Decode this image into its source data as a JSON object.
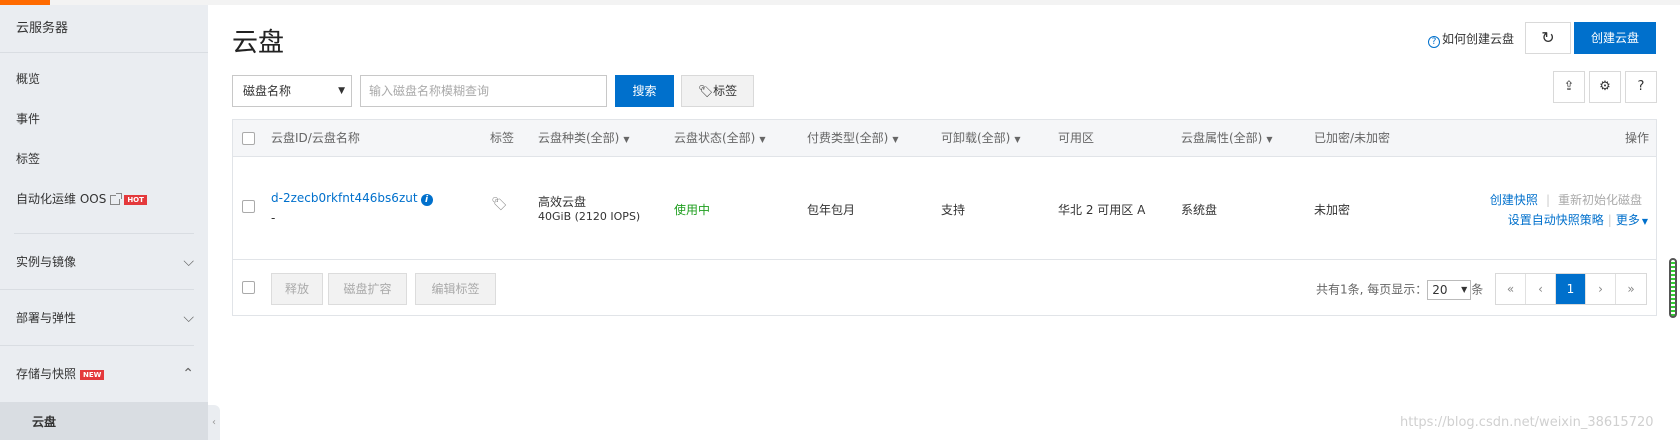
{
  "sidebar": {
    "title": "云服务器",
    "items": [
      {
        "label": "概览"
      },
      {
        "label": "事件"
      },
      {
        "label": "标签"
      },
      {
        "label": "自动化运维 OOS",
        "badge": "HOT"
      }
    ],
    "groups": [
      {
        "label": "实例与镜像",
        "chevron": "chevron-down-icon"
      },
      {
        "label": "部署与弹性",
        "chevron": "chevron-down-icon"
      },
      {
        "label": "存储与快照",
        "badge": "NEW",
        "chevron": "chevron-up-icon"
      }
    ],
    "active_sub": "云盘"
  },
  "header": {
    "title": "云盘",
    "howto_label": "如何创建云盘",
    "refresh_icon": "refresh-icon",
    "create_label": "创建云盘"
  },
  "filter": {
    "field_value": "磁盘名称",
    "search_placeholder": "输入磁盘名称模糊查询",
    "search_label": "搜索",
    "tag_label": "标签",
    "help_label": "?"
  },
  "table": {
    "columns": {
      "id": "云盘ID/云盘名称",
      "tag": "标签",
      "kind": "云盘种类(全部)",
      "status": "云盘状态(全部)",
      "billing": "付费类型(全部)",
      "detachable": "可卸载(全部)",
      "zone": "可用区",
      "attribute": "云盘属性(全部)",
      "encryption": "已加密/未加密",
      "actions": "操作"
    },
    "rows": [
      {
        "id": "d-2zecb0rkfnt446bs6zut",
        "name": "-",
        "kind": "高效云盘",
        "size": "40GiB (2120 IOPS)",
        "status": "使用中",
        "billing": "包年包月",
        "detachable": "支持",
        "zone": "华北 2 可用区 A",
        "attribute": "系统盘",
        "encryption": "未加密",
        "action_snapshot": "创建快照",
        "action_reinit": "重新初始化磁盘",
        "action_policy": "设置自动快照策略",
        "action_more": "更多"
      }
    ],
    "footer": {
      "release_label": "释放",
      "expand_label": "磁盘扩容",
      "edit_tags_label": "编辑标签",
      "total_text": "共有1条, 每页显示：",
      "page_size": "20",
      "unit": "条",
      "pages": {
        "first": "«",
        "prev": "‹",
        "current": "1",
        "next": "›",
        "last": "»"
      }
    }
  },
  "watermark": "https://blog.csdn.net/weixin_38615720",
  "colors": {
    "primary": "#0070cc",
    "accent": "#ff6a00",
    "status_ok": "#1e9e1e",
    "badge": "#e4393c"
  }
}
